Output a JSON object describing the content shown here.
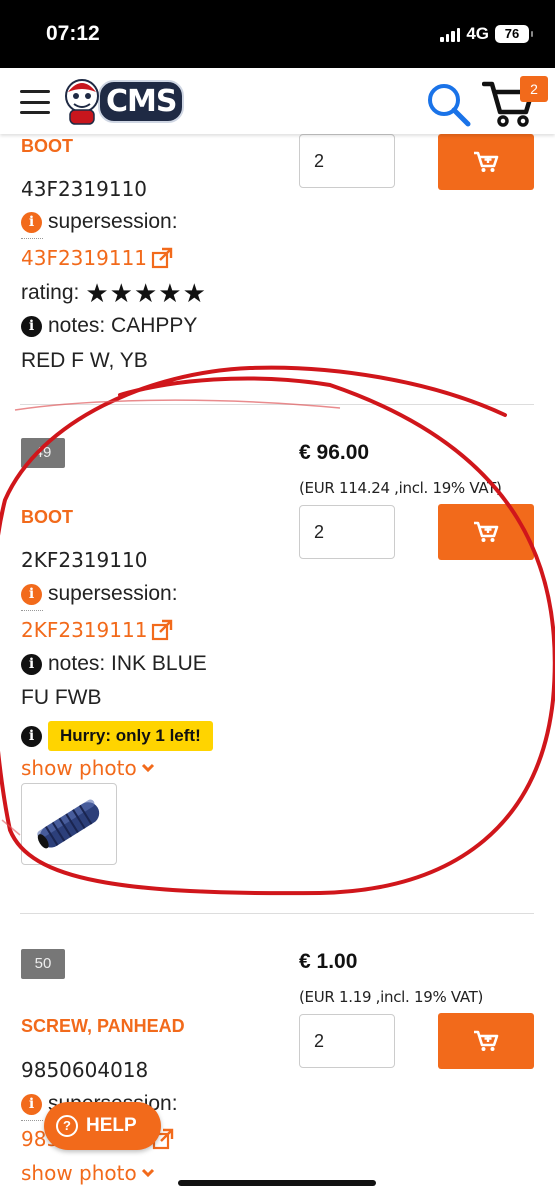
{
  "status_bar": {
    "time": "07:12",
    "network": "4G",
    "battery": "76"
  },
  "header": {
    "logo_text": "CMS",
    "cart_count": "2"
  },
  "products": [
    {
      "name": "BOOT",
      "part_number": "43F2319110",
      "supersession_label": "supersession:",
      "supersession_link": "43F2319111",
      "rating_label": "rating:",
      "rating_stars": 5,
      "notes_line1": "notes: CAHPPY",
      "notes_line2": "RED F W, YB",
      "quantity": "2"
    },
    {
      "position": "49",
      "name": "BOOT",
      "part_number": "2KF2319110",
      "supersession_label": "supersession:",
      "supersession_link": "2KF2319111",
      "notes_line1": "notes: INK BLUE",
      "notes_line2": "FU FWB",
      "stock_warning": "Hurry: only 1 left!",
      "show_photo": "show photo",
      "price": "€ 96.00",
      "price_vat": "(EUR 114.24 ,incl. 19% VAT)",
      "quantity": "2"
    },
    {
      "position": "50",
      "name": "SCREW, PANHEAD",
      "part_number": "9850604018",
      "supersession_label": "supersession:",
      "supersession_link": "9850604019",
      "show_photo": "show photo",
      "price": "€ 1.00",
      "price_vat": "(EUR 1.19 ,incl. 19% VAT)",
      "quantity": "2"
    }
  ],
  "help_button": "HELP",
  "colors": {
    "accent": "#f26a1b",
    "warning": "#ffd400",
    "scribble": "#d0161b"
  }
}
